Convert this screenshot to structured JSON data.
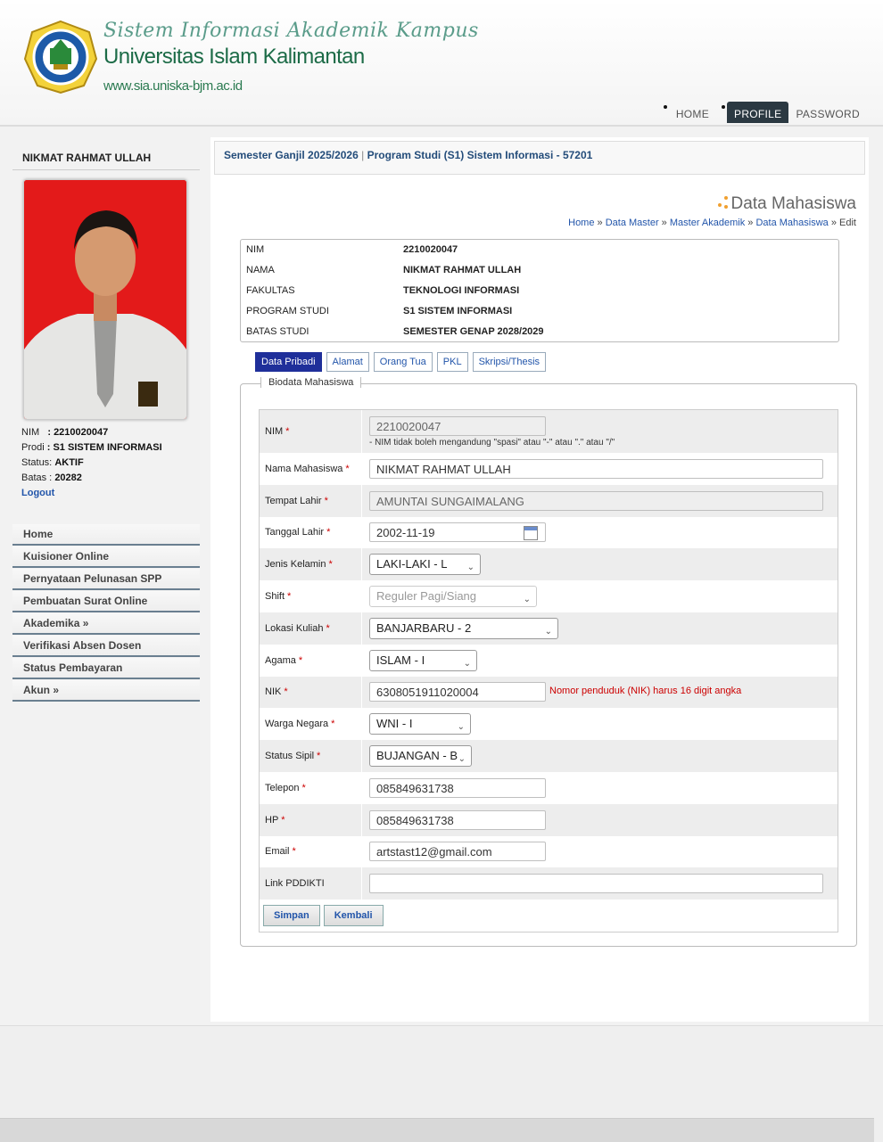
{
  "header": {
    "tagline": "Sistem Informasi Akademik Kampus",
    "university": "Universitas Islam Kalimantan",
    "url": "www.sia.uniska-bjm.ac.id",
    "nav": [
      "HOME",
      "PROFILE",
      "PASSWORD"
    ],
    "nav_active": "PROFILE"
  },
  "sidebar": {
    "user_name": "NIKMAT RAHMAT ULLAH",
    "nim_label": "NIM",
    "nim": ": 2210020047",
    "prodi_label": "Prodi",
    "prodi": ": S1 SISTEM INFORMASI",
    "status_label": "Status:",
    "status": "AKTIF",
    "batas_label": "Batas :",
    "batas": "20282",
    "logout": "Logout",
    "menu": [
      "Home",
      "Kuisioner Online",
      "Pernyataan Pelunasan SPP",
      "Pembuatan Surat Online",
      "Akademika »",
      "Verifikasi Absen Dosen",
      "Status Pembayaran",
      "Akun »"
    ]
  },
  "main": {
    "semester": "Semester Ganjil 2025/2026",
    "program": "Program Studi (S1) Sistem Informasi - 57201",
    "page_title": "Data Mahasiswa",
    "breadcrumb": [
      "Home",
      "Data Master",
      "Master Akademik",
      "Data Mahasiswa"
    ],
    "breadcrumb_current": "Edit",
    "summary": [
      {
        "k": "NIM",
        "v": "2210020047"
      },
      {
        "k": "NAMA",
        "v": "NIKMAT RAHMAT ULLAH"
      },
      {
        "k": "FAKULTAS",
        "v": "TEKNOLOGI INFORMASI"
      },
      {
        "k": "PROGRAM STUDI",
        "v": "S1 SISTEM INFORMASI"
      },
      {
        "k": "BATAS STUDI",
        "v": "SEMESTER GENAP 2028/2029"
      }
    ],
    "tabs": [
      "Data Pribadi",
      "Alamat",
      "Orang Tua",
      "PKL",
      "Skripsi/Thesis"
    ],
    "tab_active": "Data Pribadi",
    "legend": "Biodata Mahasiswa",
    "form": {
      "nim_label": "NIM",
      "nim": "2210020047",
      "nim_note": "- NIM tidak boleh mengandung \"spasi\" atau \"-\" atau \".\" atau \"/\"",
      "nama_label": "Nama Mahasiswa",
      "nama": "NIKMAT RAHMAT ULLAH",
      "tempat_label": "Tempat Lahir",
      "tempat": "AMUNTAI SUNGAIMALANG",
      "tanggal_label": "Tanggal Lahir",
      "tanggal": "2002-11-19",
      "jk_label": "Jenis Kelamin",
      "jk": "LAKI-LAKI - L",
      "shift_label": "Shift",
      "shift": "Reguler Pagi/Siang",
      "lokasi_label": "Lokasi Kuliah",
      "lokasi": "BANJARBARU - 2",
      "agama_label": "Agama",
      "agama": "ISLAM - I",
      "nik_label": "NIK",
      "nik": "6308051911020004",
      "nik_error": "Nomor penduduk (NIK) harus 16 digit angka",
      "warga_label": "Warga Negara",
      "warga": "WNI - I",
      "sipil_label": "Status Sipil",
      "sipil": "BUJANGAN - B",
      "telepon_label": "Telepon",
      "telepon": "085849631738",
      "hp_label": "HP",
      "hp": "085849631738",
      "email_label": "Email",
      "email": "artstast12@gmail.com",
      "pddikti_label": "Link PDDIKTI",
      "pddikti": "",
      "save": "Simpan",
      "back": "Kembali"
    }
  }
}
